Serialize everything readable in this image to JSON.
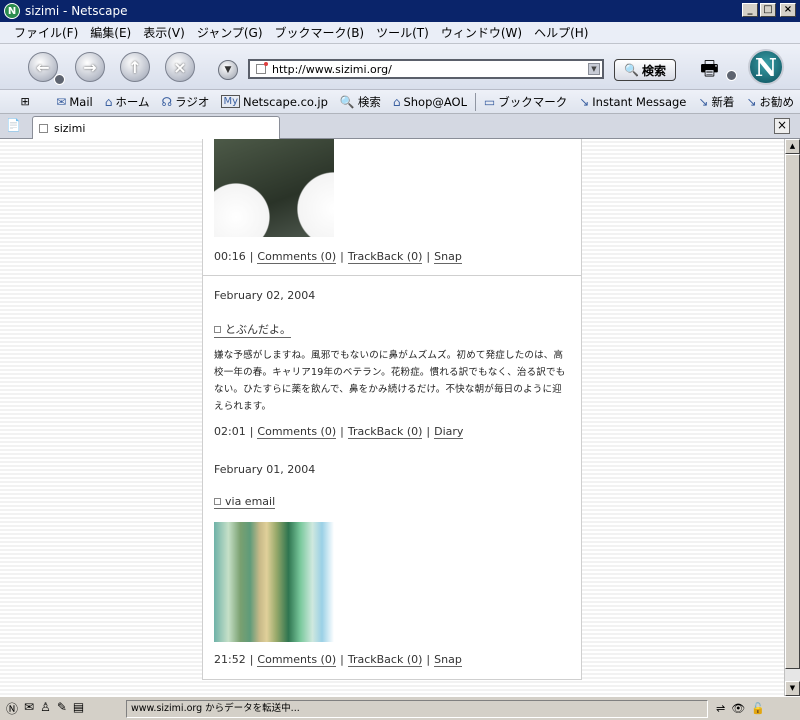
{
  "window": {
    "title": "sizimi - Netscape",
    "app_icon": "N"
  },
  "menu": [
    {
      "label": "ファイル(F)"
    },
    {
      "label": "編集(E)"
    },
    {
      "label": "表示(V)"
    },
    {
      "label": "ジャンプ(G)"
    },
    {
      "label": "ブックマーク(B)"
    },
    {
      "label": "ツール(T)"
    },
    {
      "label": "ウィンドウ(W)"
    },
    {
      "label": "ヘルプ(H)"
    }
  ],
  "navbar": {
    "url": "http://www.sizimi.org/",
    "search_label": "検索",
    "logo": "N"
  },
  "personal_toolbar": [
    {
      "label": "Mail",
      "icon": "mail-icon",
      "glyph": "✉"
    },
    {
      "label": "ホーム",
      "icon": "home-icon",
      "glyph": "⌂"
    },
    {
      "label": "ラジオ",
      "icon": "radio-icon",
      "glyph": "☊"
    },
    {
      "label": "Netscape.co.jp",
      "icon": "netscape-icon",
      "glyph": "My"
    },
    {
      "label": "検索",
      "icon": "search-icon",
      "glyph": "🔍"
    },
    {
      "label": "Shop@AOL",
      "icon": "aol-icon",
      "glyph": "⌂"
    },
    {
      "label": "ブックマーク",
      "icon": "bookmark-icon",
      "glyph": "▭"
    },
    {
      "label": "Instant Message",
      "icon": "link-icon",
      "glyph": "↘"
    },
    {
      "label": "新着",
      "icon": "link-icon",
      "glyph": "↘"
    },
    {
      "label": "お勧め",
      "icon": "link-icon",
      "glyph": "↘"
    }
  ],
  "tab": {
    "label": "sizimi"
  },
  "content": {
    "entry1_meta": {
      "time": "00:16",
      "comments": "Comments (0)",
      "trackback": "TrackBack (0)",
      "category": "Snap"
    },
    "entry2": {
      "date": "February 02, 2004",
      "title": "とぶんだよ。",
      "body": "嫌な予感がしますね。風邪でもないのに鼻がムズムズ。初めて発症したのは、高校一年の春。キャリア19年のベテラン。花粉症。慣れる訳でもなく、治る訳でもない。ひたすらに薬を飲んで、鼻をかみ続けるだけ。不快な朝が毎日のように迎えられます。",
      "time": "02:01",
      "comments": "Comments (0)",
      "trackback": "TrackBack (0)",
      "category": "Diary"
    },
    "entry3": {
      "date": "February 01, 2004",
      "title": "via email",
      "time": "21:52",
      "comments": "Comments (0)",
      "trackback": "TrackBack (0)",
      "category": "Snap"
    },
    "separator": "|"
  },
  "status": {
    "text": "www.sizimi.org からデータを転送中..."
  }
}
